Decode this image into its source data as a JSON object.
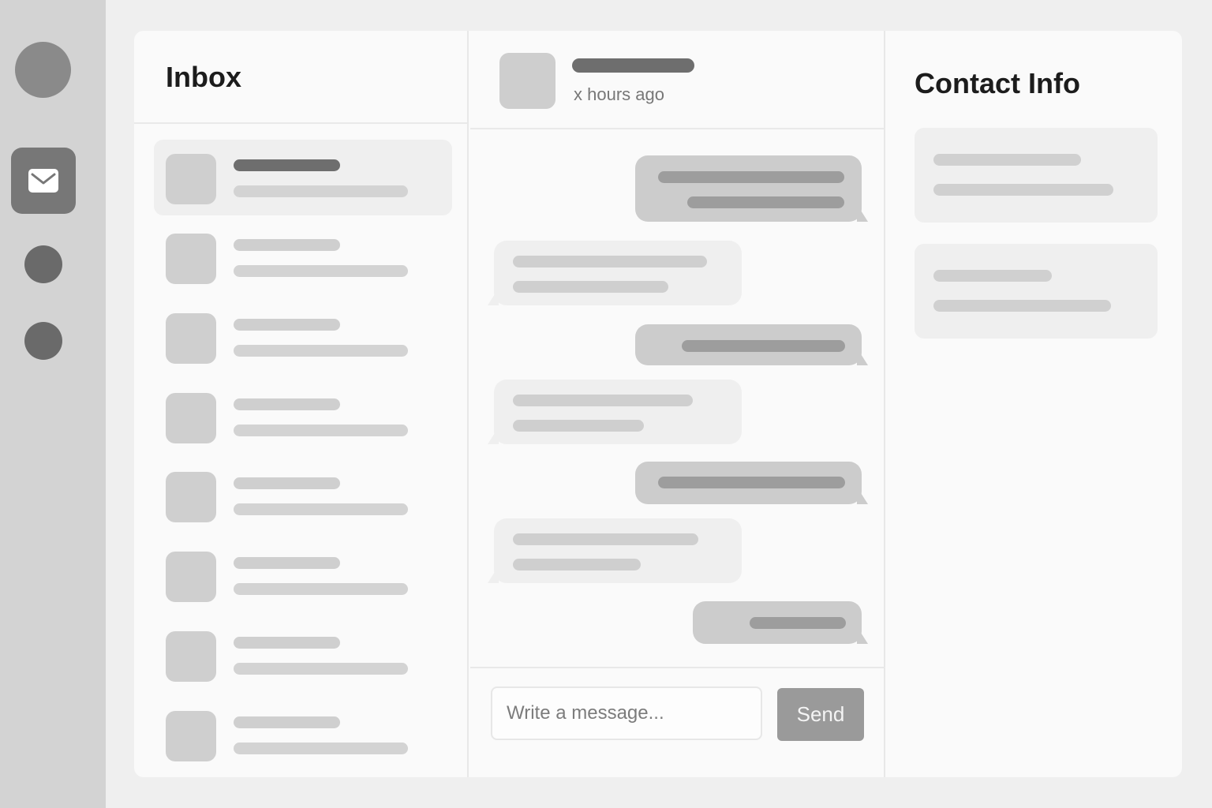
{
  "rail": {
    "items": [
      {
        "name": "profile-avatar"
      },
      {
        "name": "mail",
        "icon": "envelope-icon",
        "active": true
      },
      {
        "name": "nav-item-2"
      },
      {
        "name": "nav-item-3"
      }
    ]
  },
  "inbox": {
    "title": "Inbox",
    "conversation_count": 8,
    "active_index": 0
  },
  "chat": {
    "header": {
      "time": "x hours ago"
    },
    "composer": {
      "placeholder": "Write a message...",
      "send_label": "Send"
    }
  },
  "contact": {
    "title": "Contact Info"
  },
  "colors": {
    "rail_bg": "#d3d3d3",
    "card_bg": "#fafafa",
    "active_icon_bg": "#777777",
    "send_button_bg": "#9a9a9a"
  }
}
